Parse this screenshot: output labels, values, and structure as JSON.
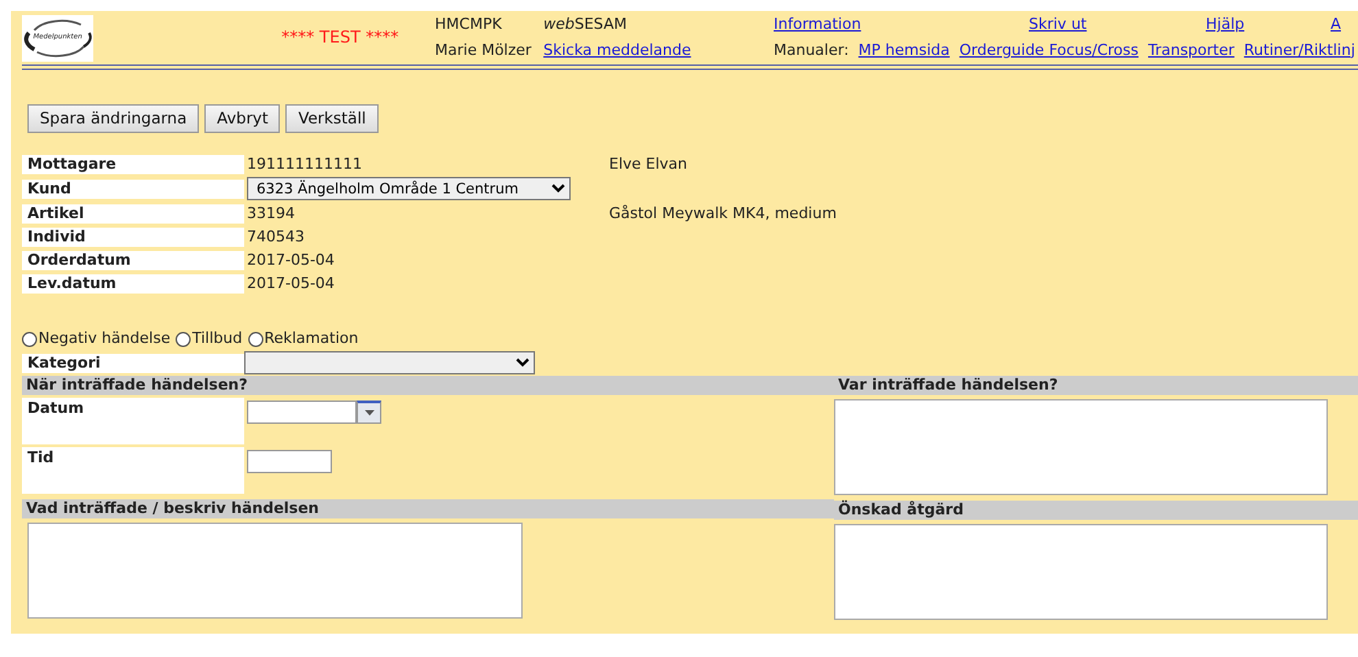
{
  "header": {
    "logo_text": "Medelpunkten",
    "test_banner": "**** TEST ****",
    "user_code": "HMCMPK",
    "app_name": {
      "italic_part": "web",
      "rest": "SESAM"
    },
    "user_name": "Marie Mölzer",
    "top_links": [
      "Information",
      "Skriv ut",
      "Hjälp",
      "A"
    ],
    "send_message": "Skicka meddelande",
    "manuals_label": "Manualer:",
    "manuals": [
      "MP hemsida",
      "Orderguide Focus/Cross",
      "Transporter",
      "Rutiner/Riktlinj"
    ]
  },
  "buttons": [
    "Spara ändringarna",
    "Avbryt",
    "Verkställ"
  ],
  "info": [
    {
      "label": "Mottagare",
      "kind": "text",
      "value": "191111111111",
      "extra": "Elve Elvan"
    },
    {
      "label": "Kund",
      "kind": "select",
      "value": "6323 Ängelholm Område 1 Centrum"
    },
    {
      "label": "Artikel",
      "kind": "text",
      "value": "33194",
      "extra": "Gåstol Meywalk MK4, medium"
    },
    {
      "label": "Individ",
      "kind": "text",
      "value": "740543"
    },
    {
      "label": "Orderdatum",
      "kind": "text",
      "value": "2017-05-04"
    },
    {
      "label": "Lev.datum",
      "kind": "text",
      "value": "2017-05-04"
    }
  ],
  "event_types": [
    {
      "label": "Negativ händelse",
      "selected": false
    },
    {
      "label": "Tillbud",
      "selected": false
    },
    {
      "label": "Reklamation",
      "selected": false
    }
  ],
  "category": {
    "label": "Kategori"
  },
  "when": {
    "title": "När inträffade händelsen?",
    "fields": [
      {
        "label": "Datum",
        "kind": "date"
      },
      {
        "label": "Tid",
        "kind": "time"
      }
    ]
  },
  "where": {
    "title": "Var inträffade händelsen?"
  },
  "describe": {
    "title": "Vad inträffade / beskriv händelsen"
  },
  "action": {
    "title": "Önskad åtgärd"
  }
}
